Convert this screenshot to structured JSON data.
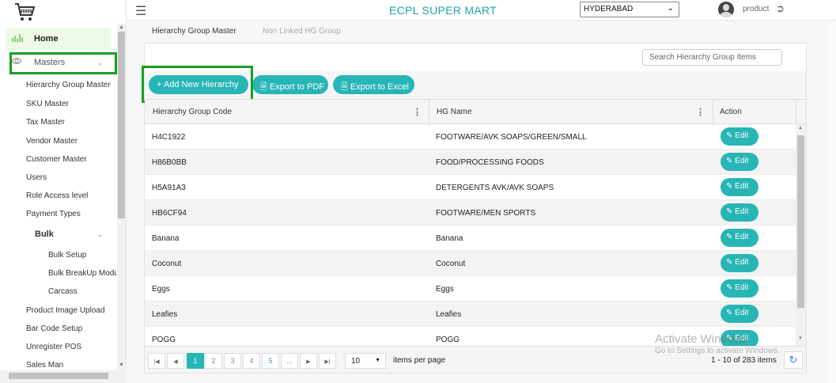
{
  "header": {
    "app_title": "ECPL SUPER MART",
    "city": "HYDERABAD",
    "user": "product"
  },
  "sidebar": {
    "home": "Home",
    "masters": "Masters",
    "items": [
      "Hierarchy Group Master",
      "SKU Master",
      "Tax Master",
      "Vendor Master",
      "Customer Master",
      "Users",
      "Role Access level",
      "Payment Types"
    ],
    "bulk": "Bulk",
    "bulk_items": [
      "Bulk Setup",
      "Bulk BreakUp Modu",
      "Carcass"
    ],
    "more_items": [
      "Product Image Upload",
      "Bar Code Setup",
      "Unregister POS",
      "Sales Man"
    ]
  },
  "tabs": {
    "active": "Hierarchy Group Master",
    "inactive": "Non Linked HG Group"
  },
  "search": {
    "placeholder": "Search Hierarchy Group Items"
  },
  "toolbar": {
    "add": "Add New Hierarchy",
    "pdf": "Export to PDF",
    "excel": "Export to Excel"
  },
  "grid": {
    "columns": [
      "Hierarchy Group Code",
      "HG Name",
      "Action"
    ],
    "edit_label": "Edit",
    "rows": [
      {
        "code": "H4C1922",
        "name": "FOOTWARE/AVK SOAPS/GREEN/SMALL"
      },
      {
        "code": "H86B0BB",
        "name": "FOOD/PROCESSING FOODS"
      },
      {
        "code": "H5A91A3",
        "name": "DETERGENTS AVK/AVK SOAPS"
      },
      {
        "code": "HB6CF94",
        "name": "FOOTWARE/MEN SPORTS"
      },
      {
        "code": "Banana",
        "name": "Banana"
      },
      {
        "code": "Coconut",
        "name": "Coconut"
      },
      {
        "code": "Eggs",
        "name": "Eggs"
      },
      {
        "code": "Leafies",
        "name": "Leafies"
      },
      {
        "code": "POGG",
        "name": "POGG"
      }
    ]
  },
  "pager": {
    "pages": [
      "1",
      "2",
      "3",
      "4",
      "5",
      "..."
    ],
    "page_size": "10",
    "items_per_page": "items per page",
    "count": "1 - 10 of 283 items"
  },
  "watermark": {
    "line1": "Activate Windows",
    "line2": "Go to Settings to activate Windows."
  },
  "colors": {
    "accent": "#28b5b5",
    "title": "#1fa6a6",
    "highlight": "#1a9e22"
  }
}
